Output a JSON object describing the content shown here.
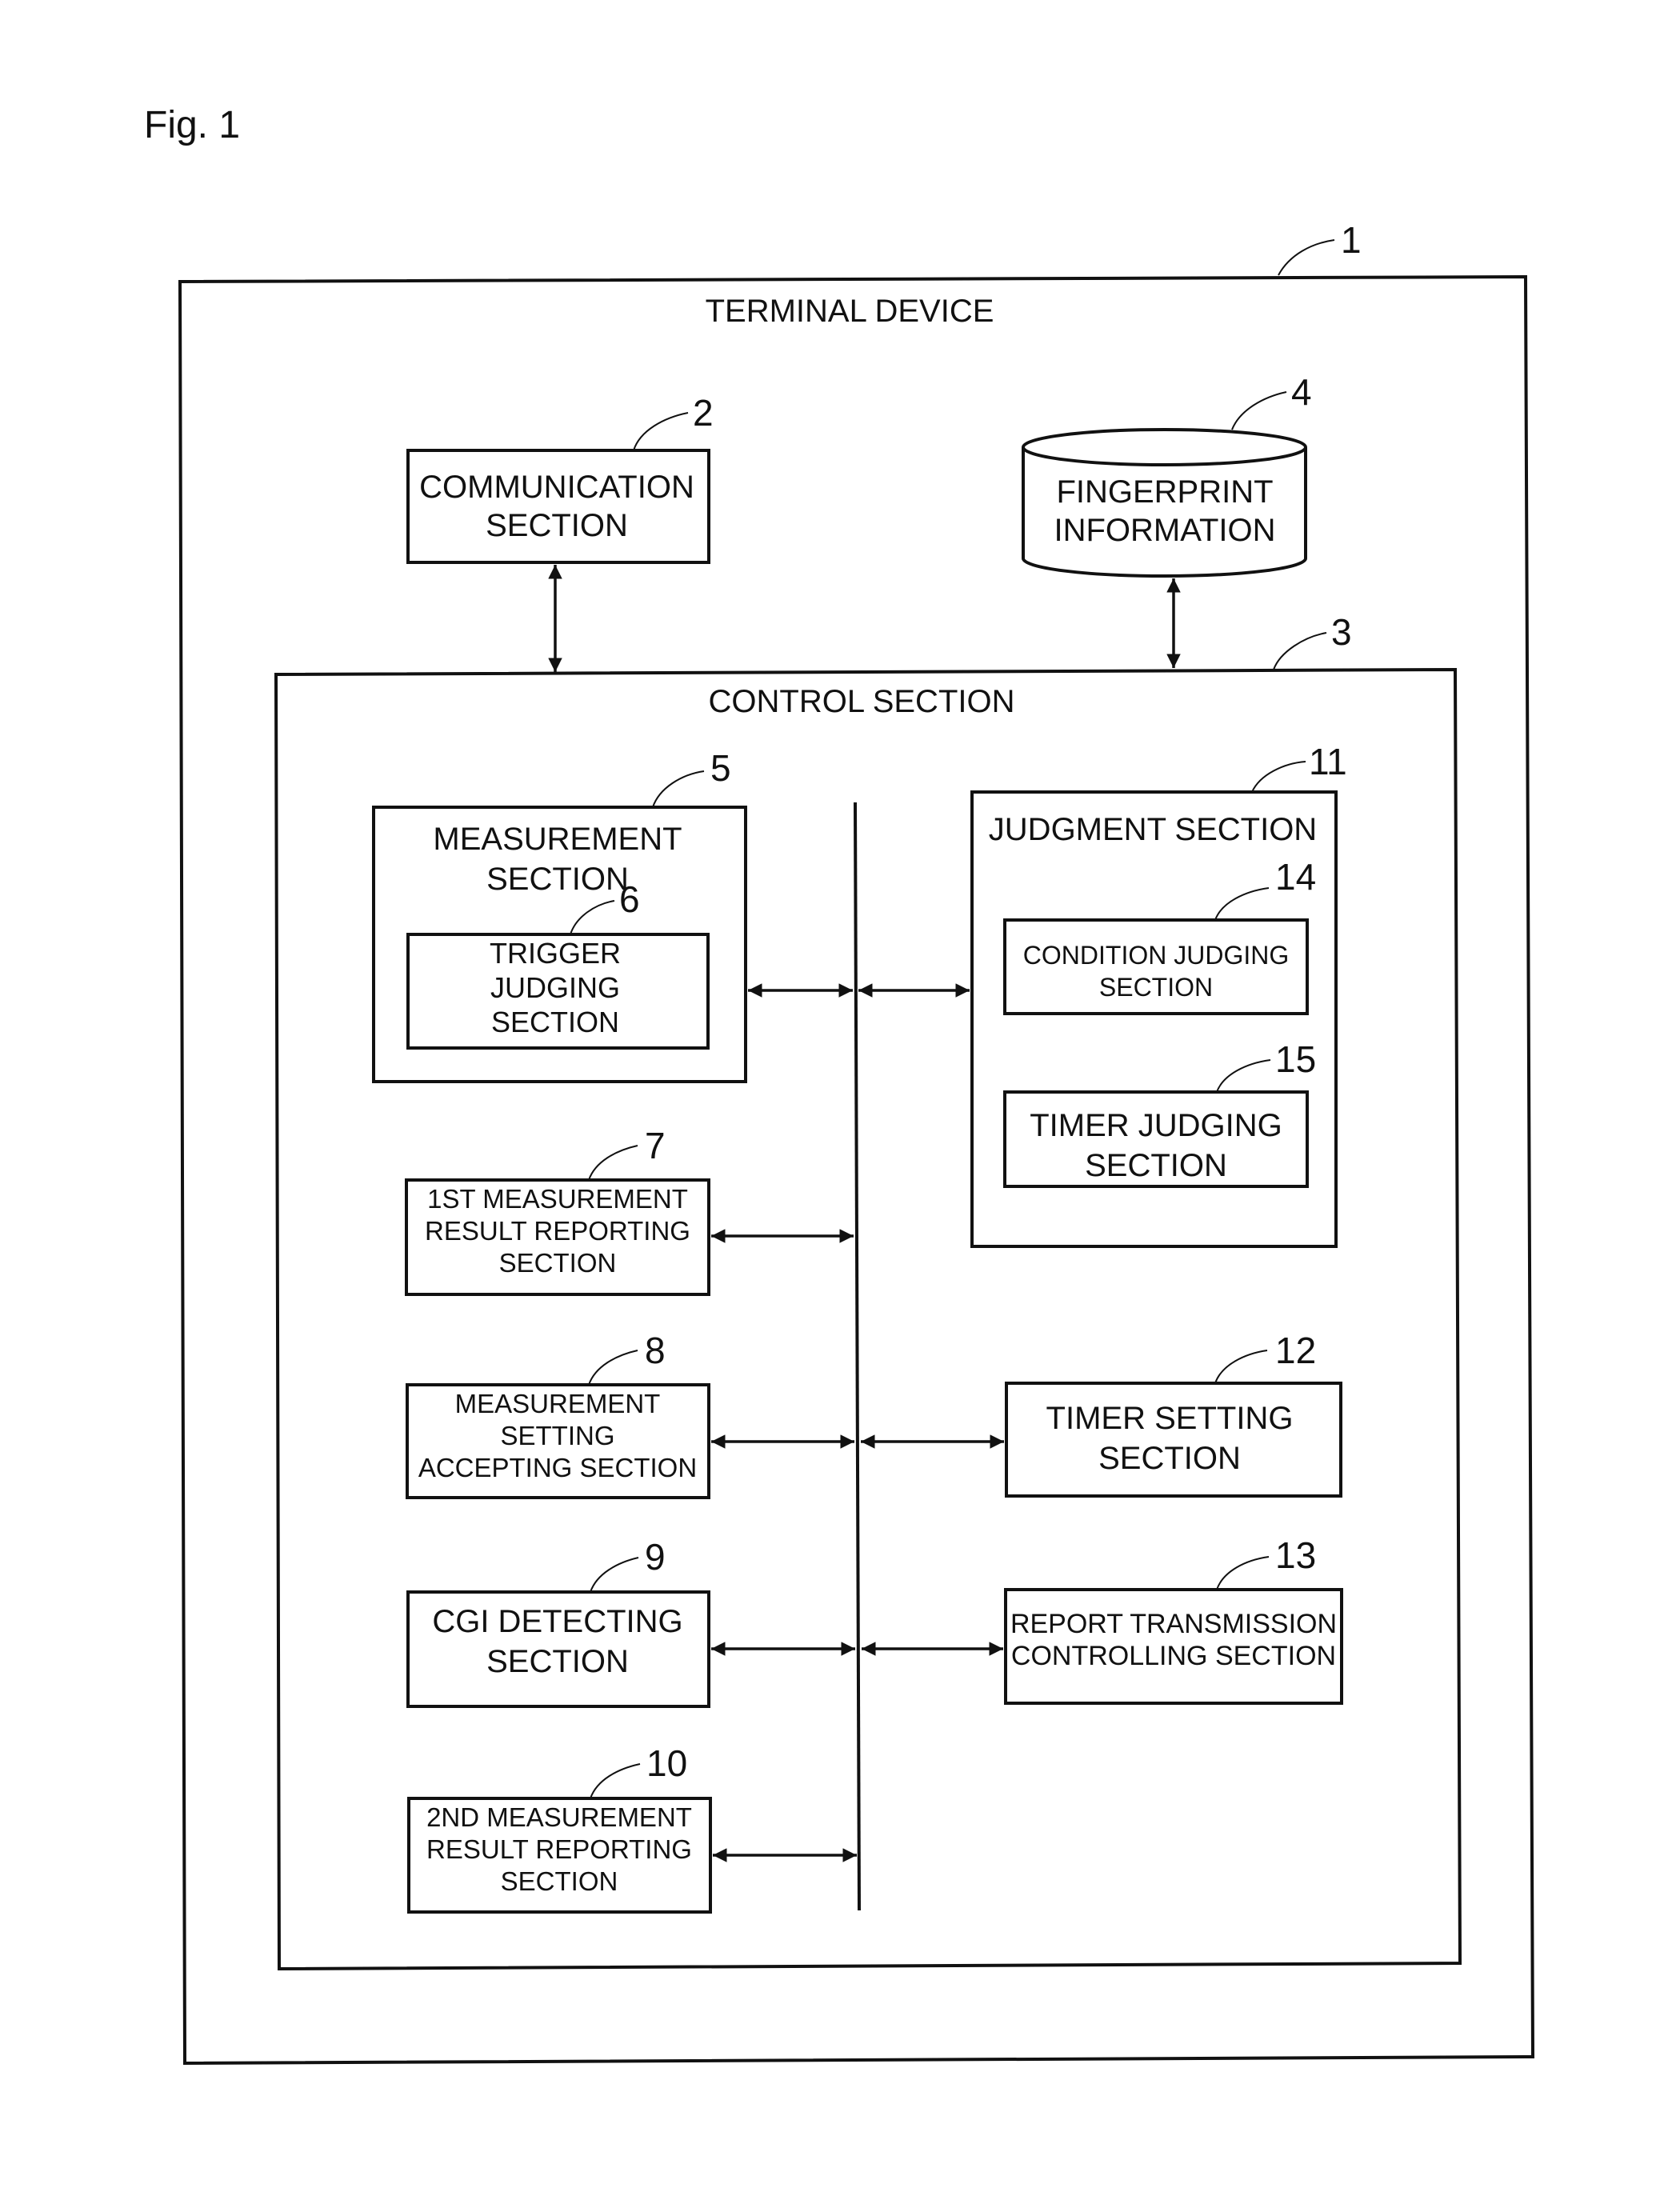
{
  "figure_label": "Fig. 1",
  "terminal_device": {
    "ref": "1",
    "title": "TERMINAL DEVICE"
  },
  "communication_section": {
    "ref": "2",
    "lines": [
      "COMMUNICATION",
      "SECTION"
    ]
  },
  "control_section": {
    "ref": "3",
    "title": "CONTROL SECTION"
  },
  "fingerprint_information": {
    "ref": "4",
    "lines": [
      "FINGERPRINT",
      "INFORMATION"
    ]
  },
  "measurement_section": {
    "ref": "5",
    "lines": [
      "MEASUREMENT",
      "SECTION"
    ]
  },
  "trigger_judging_section": {
    "ref": "6",
    "lines": [
      "TRIGGER",
      "JUDGING",
      "SECTION"
    ]
  },
  "first_result_reporting_section": {
    "ref": "7",
    "lines": [
      "1ST MEASUREMENT",
      "RESULT REPORTING",
      "SECTION"
    ]
  },
  "measurement_setting_accepting_section": {
    "ref": "8",
    "lines": [
      "MEASUREMENT",
      "SETTING",
      "ACCEPTING SECTION"
    ]
  },
  "cgi_detecting_section": {
    "ref": "9",
    "lines": [
      "CGI DETECTING",
      "SECTION"
    ]
  },
  "second_result_reporting_section": {
    "ref": "10",
    "lines": [
      "2ND MEASUREMENT",
      "RESULT REPORTING",
      "SECTION"
    ]
  },
  "judgment_section": {
    "ref": "11",
    "title": "JUDGMENT SECTION"
  },
  "timer_setting_section": {
    "ref": "12",
    "lines": [
      "TIMER SETTING",
      "SECTION"
    ]
  },
  "report_transmission_controlling_section": {
    "ref": "13",
    "lines": [
      "REPORT TRANSMISSION",
      "CONTROLLING SECTION"
    ]
  },
  "condition_judging_section": {
    "ref": "14",
    "lines": [
      "CONDITION JUDGING",
      "SECTION"
    ]
  },
  "timer_judging_section": {
    "ref": "15",
    "lines": [
      "TIMER JUDGING",
      "SECTION"
    ]
  }
}
